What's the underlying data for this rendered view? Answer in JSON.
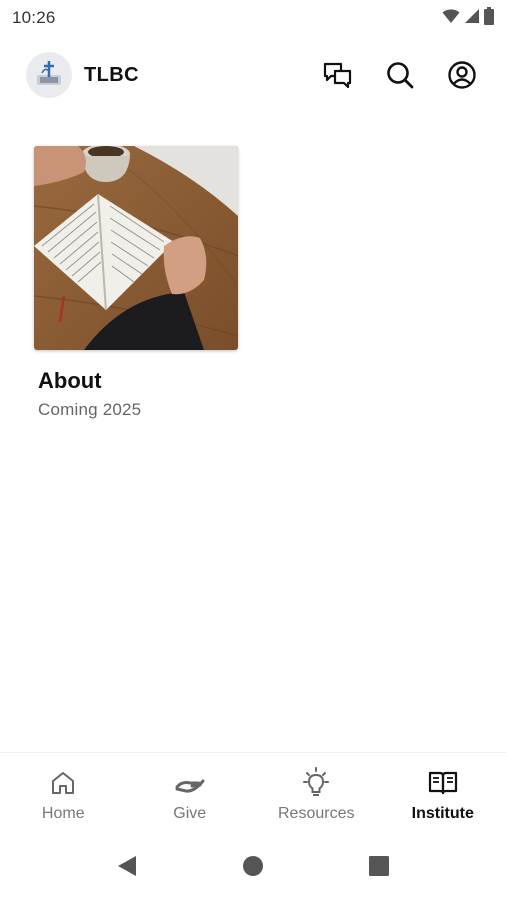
{
  "status_bar": {
    "time": "10:26",
    "icons": [
      "wifi-icon",
      "cellular-icon",
      "battery-icon"
    ]
  },
  "header": {
    "logo_icon": "church-logo",
    "title": "TLBC",
    "actions": [
      {
        "name": "chat-icon"
      },
      {
        "name": "search-icon"
      },
      {
        "name": "account-icon"
      }
    ]
  },
  "main": {
    "cards": [
      {
        "title": "About",
        "subtitle": "Coming 2025",
        "image": "open-bible-on-wooden-table-photo"
      }
    ]
  },
  "bottom_nav": {
    "items": [
      {
        "label": "Home",
        "icon": "home-icon",
        "active": false
      },
      {
        "label": "Give",
        "icon": "give-hand-icon",
        "active": false
      },
      {
        "label": "Resources",
        "icon": "lightbulb-icon",
        "active": false
      },
      {
        "label": "Institute",
        "icon": "open-book-icon",
        "active": true
      }
    ]
  },
  "system_nav": {
    "buttons": [
      "back-icon",
      "home-circle-icon",
      "recents-square-icon"
    ]
  },
  "colors": {
    "background": "#ffffff",
    "text_primary": "#111111",
    "text_secondary": "#666666",
    "nav_inactive": "#777777",
    "system_button": "#555555"
  }
}
